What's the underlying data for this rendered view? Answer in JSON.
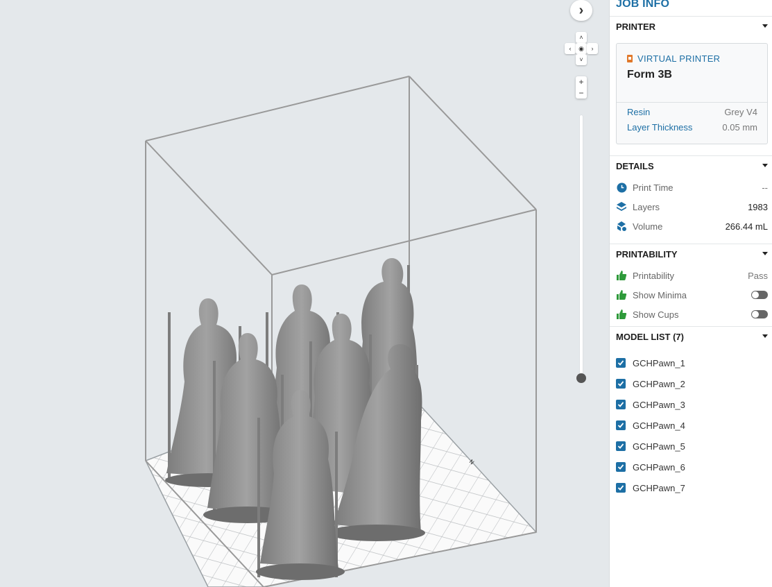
{
  "viewport": {
    "collapse_icon": "chevron-right-icon",
    "zoom_in_label": "+",
    "zoom_out_label": "−"
  },
  "sidebar": {
    "title": "JOB INFO",
    "printer": {
      "header": "PRINTER",
      "type_label": "VIRTUAL PRINTER",
      "name": "Form 3B",
      "resin_label": "Resin",
      "resin_value": "Grey V4",
      "layer_thickness_label": "Layer Thickness",
      "layer_thickness_value": "0.05 mm"
    },
    "details": {
      "header": "DETAILS",
      "print_time_label": "Print Time",
      "print_time_value": "--",
      "layers_label": "Layers",
      "layers_value": "1983",
      "volume_label": "Volume",
      "volume_value": "266.44 mL"
    },
    "printability": {
      "header": "PRINTABILITY",
      "printability_label": "Printability",
      "printability_value": "Pass",
      "show_minima_label": "Show Minima",
      "show_cups_label": "Show Cups"
    },
    "model_list": {
      "header": "MODEL LIST (7)",
      "items": [
        "GCHPawn_1",
        "GCHPawn_2",
        "GCHPawn_3",
        "GCHPawn_4",
        "GCHPawn_5",
        "GCHPawn_6",
        "GCHPawn_7"
      ]
    }
  },
  "colors": {
    "accent": "#1d6fa5",
    "pass_green": "#2e9a3a",
    "viewport_bg": "#e4e8eb",
    "model_grey": "#8c8c8c"
  }
}
